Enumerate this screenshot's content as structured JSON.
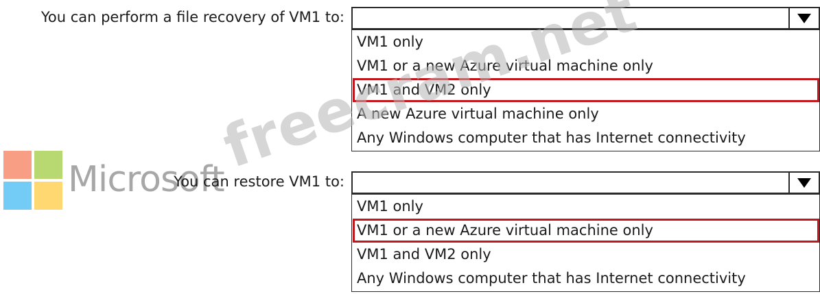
{
  "questions": [
    {
      "prompt": "You can perform a file recovery of VM1 to:",
      "selected_value": "",
      "options": [
        "VM1 only",
        "VM1 or a new Azure virtual machine only",
        "VM1 and VM2 only",
        "A new Azure virtual machine only",
        "Any Windows computer that has Internet connectivity"
      ],
      "highlighted_option": "VM1 and VM2 only"
    },
    {
      "prompt": "You can restore VM1 to:",
      "selected_value": "",
      "options": [
        "VM1 only",
        "VM1 or a new Azure virtual machine only",
        "VM1 and VM2 only",
        "Any Windows computer that has Internet connectivity"
      ],
      "highlighted_option": "VM1 or a new Azure virtual machine only"
    }
  ],
  "watermarks": {
    "brand_text": "Microsoft",
    "site_text": "freecram.net"
  },
  "colors": {
    "highlight": "#c0161c",
    "border": "#2a2a2a",
    "logo_red": "#f25022",
    "logo_green": "#7fba00",
    "logo_blue": "#00a4ef",
    "logo_yellow": "#ffb900"
  },
  "icons": {
    "dropdown": "dropdown-arrow-icon",
    "logo": "microsoft-logo-icon"
  }
}
